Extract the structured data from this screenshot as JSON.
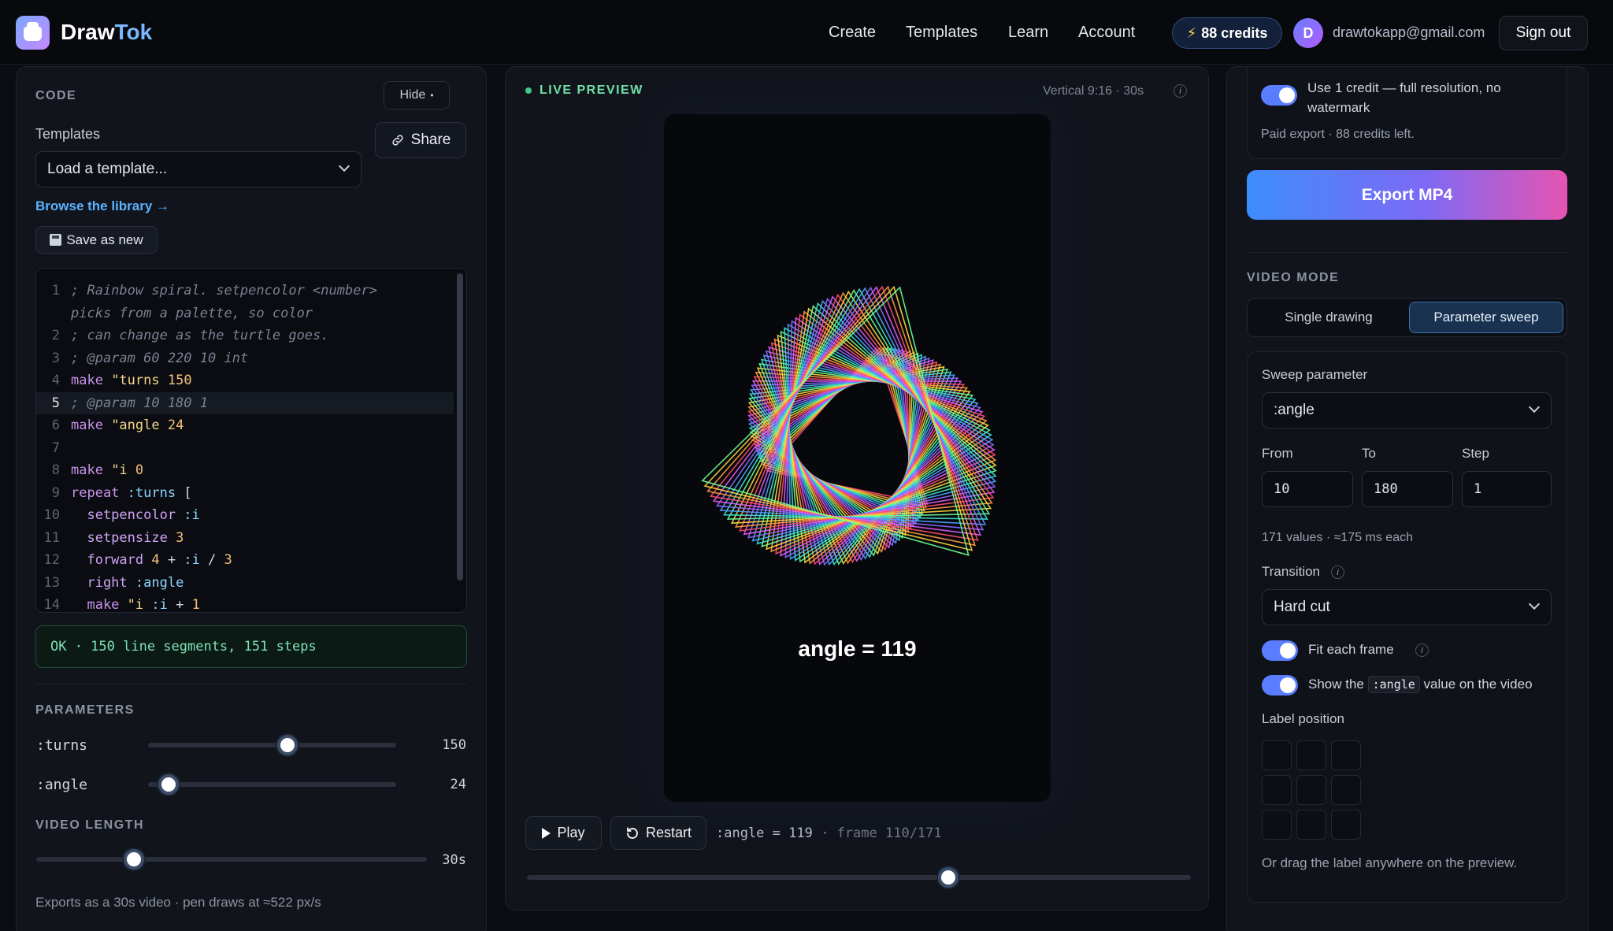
{
  "nav": {
    "brand_part1": "Draw",
    "brand_part2": "Tok",
    "links": [
      "Create",
      "Templates",
      "Learn",
      "Account"
    ],
    "credits": "88 credits",
    "avatar_initial": "D",
    "email": "drawtokapp@gmail.com",
    "signout": "Sign out"
  },
  "code_panel": {
    "title": "CODE",
    "hide": "Hide",
    "templates_label": "Templates",
    "template_select": "Load a template...",
    "share": "Share",
    "browse": "Browse the library →",
    "save_new": "Save as new",
    "lines": [
      {
        "n": "1",
        "parts": [
          {
            "t": "; Rainbow spiral. setpencolor <number>",
            "c": "c-comment"
          }
        ]
      },
      {
        "n": "",
        "parts": [
          {
            "t": "picks from a palette, so color",
            "c": "c-comment"
          }
        ]
      },
      {
        "n": "2",
        "parts": [
          {
            "t": "; can change as the turtle goes.",
            "c": "c-comment"
          }
        ]
      },
      {
        "n": "3",
        "parts": [
          {
            "t": "; @param 60 220 10 int",
            "c": "c-comment"
          }
        ]
      },
      {
        "n": "4",
        "parts": [
          {
            "t": "make ",
            "c": "c-kw"
          },
          {
            "t": "\"turns ",
            "c": "c-str"
          },
          {
            "t": "150",
            "c": "c-num"
          }
        ]
      },
      {
        "n": "5",
        "parts": [
          {
            "t": "; @param 10 180 1",
            "c": "c-comment"
          }
        ],
        "active": true
      },
      {
        "n": "6",
        "parts": [
          {
            "t": "make ",
            "c": "c-kw"
          },
          {
            "t": "\"angle ",
            "c": "c-str"
          },
          {
            "t": "24",
            "c": "c-num"
          }
        ]
      },
      {
        "n": "7",
        "parts": [
          {
            "t": "",
            "c": "c-plain"
          }
        ]
      },
      {
        "n": "8",
        "parts": [
          {
            "t": "make ",
            "c": "c-kw"
          },
          {
            "t": "\"i ",
            "c": "c-str"
          },
          {
            "t": "0",
            "c": "c-num"
          }
        ]
      },
      {
        "n": "9",
        "parts": [
          {
            "t": "repeat ",
            "c": "c-kw"
          },
          {
            "t": ":turns ",
            "c": "c-var"
          },
          {
            "t": "[",
            "c": "c-plain"
          }
        ]
      },
      {
        "n": "10",
        "parts": [
          {
            "t": "  setpencolor ",
            "c": "c-fn"
          },
          {
            "t": ":i",
            "c": "c-var"
          }
        ]
      },
      {
        "n": "11",
        "parts": [
          {
            "t": "  setpensize ",
            "c": "c-fn"
          },
          {
            "t": "3",
            "c": "c-num"
          }
        ]
      },
      {
        "n": "12",
        "parts": [
          {
            "t": "  forward ",
            "c": "c-fn"
          },
          {
            "t": "4 ",
            "c": "c-num"
          },
          {
            "t": "+ ",
            "c": "c-plain"
          },
          {
            "t": ":i ",
            "c": "c-var"
          },
          {
            "t": "/ ",
            "c": "c-plain"
          },
          {
            "t": "3",
            "c": "c-num"
          }
        ]
      },
      {
        "n": "13",
        "parts": [
          {
            "t": "  right ",
            "c": "c-fn"
          },
          {
            "t": ":angle",
            "c": "c-var"
          }
        ]
      },
      {
        "n": "14",
        "parts": [
          {
            "t": "  make ",
            "c": "c-kw"
          },
          {
            "t": "\"i ",
            "c": "c-str"
          },
          {
            "t": ":i ",
            "c": "c-var"
          },
          {
            "t": "+ ",
            "c": "c-plain"
          },
          {
            "t": "1",
            "c": "c-num"
          }
        ]
      }
    ],
    "status": "OK · 150 line segments, 151 steps",
    "params_title": "PARAMETERS",
    "params": [
      {
        "name": ":turns",
        "value": "150",
        "min": 60,
        "max": 220,
        "current": 150
      },
      {
        "name": ":angle",
        "value": "24",
        "min": 10,
        "max": 180,
        "current": 24
      }
    ],
    "video_length_title": "VIDEO LENGTH",
    "video_length_value": "30s",
    "video_length_fraction": 0.25,
    "export_note": "Exports as a 30s video · pen draws at ≈522 px/s"
  },
  "preview": {
    "live_label": "LIVE PREVIEW",
    "format": "Vertical 9:16 · 30s",
    "overlay_label": "angle = 119",
    "play": "Play",
    "restart": "Restart",
    "frame_param": ":angle = 119",
    "frame_sep": "·",
    "frame_count": "frame 110/171",
    "scrub_fraction": 0.635
  },
  "export": {
    "credit_toggle_text": "Use 1 credit — full resolution, no watermark",
    "paid_note": "Paid export · 88 credits left.",
    "export_button": "Export MP4"
  },
  "video_mode": {
    "title": "VIDEO MODE",
    "tabs": [
      "Single drawing",
      "Parameter sweep"
    ],
    "active_tab": 1,
    "sweep_param_label": "Sweep parameter",
    "sweep_param": ":angle",
    "from_label": "From",
    "to_label": "To",
    "step_label": "Step",
    "from": "10",
    "to": "180",
    "step": "1",
    "values_note": "171 values · ≈175 ms each",
    "transition_label": "Transition",
    "transition": "Hard cut",
    "fit_each_frame": "Fit each frame",
    "show_the": "Show the",
    "show_code": ":angle",
    "show_rest": "value on the video",
    "label_position": "Label position",
    "drag_note": "Or drag the label anywhere on the preview."
  },
  "colors": {
    "accent": "#5a7dff",
    "ok_green": "#7fe3b6",
    "link_blue": "#5cb3ff"
  }
}
